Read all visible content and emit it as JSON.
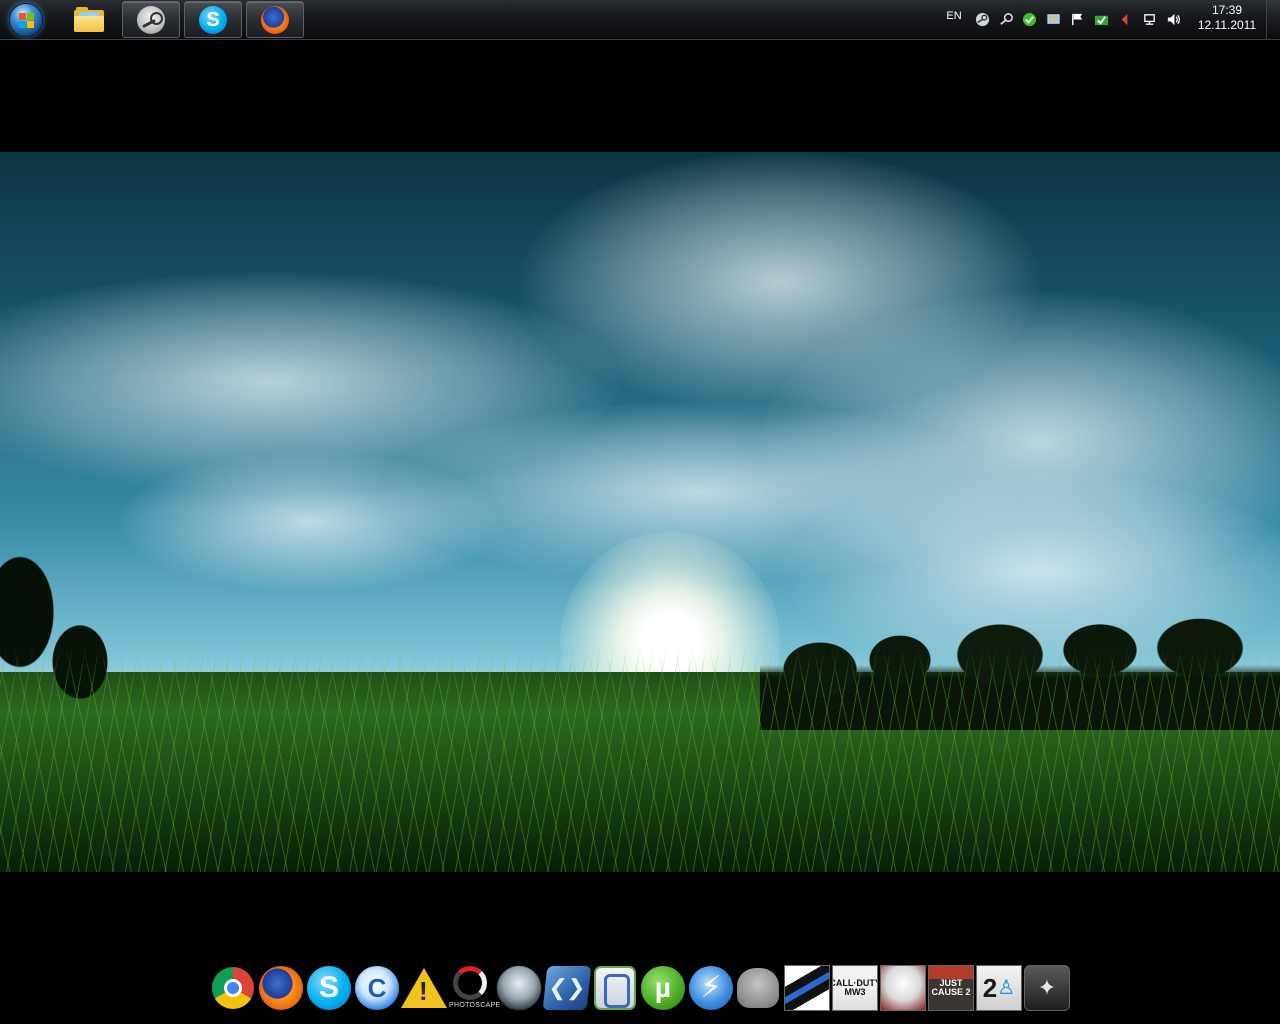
{
  "taskbar": {
    "start_button": "start-orb",
    "pinned": [
      {
        "name": "windows-explorer",
        "icon": "folder-icon",
        "running": false
      },
      {
        "name": "steam",
        "icon": "steam-icon",
        "running": true
      },
      {
        "name": "skype",
        "icon": "skype-icon",
        "running": true
      },
      {
        "name": "firefox",
        "icon": "firefox-icon",
        "running": true
      }
    ],
    "skype_glyph": "S"
  },
  "tray": {
    "language": "EN",
    "icons": [
      "steam-tray-icon",
      "steam-controller-icon",
      "green-check-icon",
      "network-status-icon",
      "action-center-flag-icon",
      "green-shield-icon",
      "red-arrow-icon",
      "network-icon",
      "volume-icon"
    ],
    "time": "17:39",
    "date": "12.11.2011"
  },
  "wallpaper": {
    "description_icon": "grass-field-sunset-wallpaper"
  },
  "dock": {
    "items": [
      {
        "name": "google-chrome",
        "icon": "chrome-icon"
      },
      {
        "name": "firefox",
        "icon": "firefox-icon"
      },
      {
        "name": "skype",
        "icon": "skype-icon",
        "glyph": "S"
      },
      {
        "name": "ccleaner",
        "icon": "ccleaner-icon",
        "glyph": "C"
      },
      {
        "name": "warning-app",
        "icon": "warning-icon"
      },
      {
        "name": "photoscape",
        "icon": "photoscape-icon",
        "label": "PHOTOSCAPE"
      },
      {
        "name": "steam",
        "icon": "steam-icon"
      },
      {
        "name": "xml-app",
        "icon": "xml-icon"
      },
      {
        "name": "green-frame-app",
        "icon": "frame-icon"
      },
      {
        "name": "utorrent",
        "icon": "utorrent-icon",
        "glyph": "µ"
      },
      {
        "name": "daemon-tools",
        "icon": "lightning-icon",
        "glyph": "⚡"
      },
      {
        "name": "elephant-app",
        "icon": "elephant-icon"
      },
      {
        "name": "stripes-game",
        "icon": "stripes-tile-icon"
      },
      {
        "name": "call-of-duty-mw3",
        "icon": "call-of-duty-icon",
        "label": "CALL·DUTY MW3"
      },
      {
        "name": "assassins-creed",
        "icon": "assassins-creed-icon"
      },
      {
        "name": "just-cause-2",
        "icon": "just-cause-icon",
        "label": "JUST CAUSE 2"
      },
      {
        "name": "portal-2",
        "icon": "portal-icon",
        "glyph": "2"
      },
      {
        "name": "wings-app",
        "icon": "wings-icon"
      }
    ]
  }
}
